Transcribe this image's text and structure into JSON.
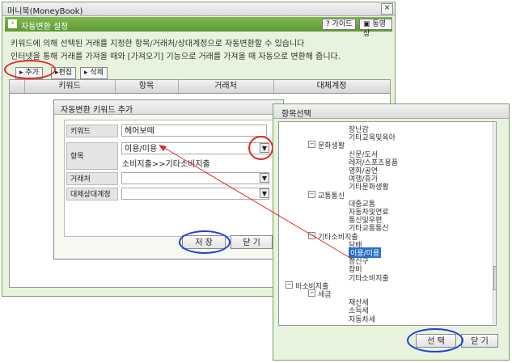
{
  "main": {
    "window_title": "머니북(MoneyBook)",
    "close": "×",
    "header": "자동변환 설정",
    "guide_button": "? 가이드",
    "video_button": "동영상",
    "desc_line1": "키워드에 의해 선택된 거래를 지정한 항목/거래처/상대계정으로 자동변환할 수 있습니다",
    "desc_line2": "인터넷을 통해 거래를 가져올 때와 [가져오기] 기능으로 거래를 가져올 때 자동으로 변환해 줍니다.",
    "toolbar": {
      "add": "추가",
      "edit": "편집",
      "delete": "삭제"
    },
    "columns": [
      "키워드",
      "항목",
      "거래처",
      "대체계정"
    ]
  },
  "dialog": {
    "title": "자동변환 키워드 추가",
    "labels": {
      "keyword": "키워드",
      "item": "항목",
      "vendor": "거래처",
      "counter": "대체상대계정"
    },
    "keyword_value": "헤어보떼",
    "item_value": "이용/미용",
    "item_path": "소비지출>>기타소비지출",
    "save": "저 장",
    "close": "닫 기"
  },
  "tree": {
    "title": "항목선택",
    "items": [
      {
        "label": "장난감",
        "level": 3
      },
      {
        "label": "기타교육및육아",
        "level": 3
      },
      {
        "label": "문화생활",
        "level": 2,
        "toggle": "−"
      },
      {
        "label": "신문/도서",
        "level": 3
      },
      {
        "label": "레저/스포츠용품",
        "level": 3
      },
      {
        "label": "영화/공연",
        "level": 3
      },
      {
        "label": "여행/휴가",
        "level": 3
      },
      {
        "label": "기타문화생활",
        "level": 3
      },
      {
        "label": "교통통신",
        "level": 2,
        "toggle": "−"
      },
      {
        "label": "대중교통",
        "level": 3
      },
      {
        "label": "자동차및연료",
        "level": 3
      },
      {
        "label": "통신및우편",
        "level": 3
      },
      {
        "label": "기타교통통신",
        "level": 3
      },
      {
        "label": "기타소비지출",
        "level": 2,
        "toggle": "−"
      },
      {
        "label": "담배",
        "level": 3
      },
      {
        "label": "이용/미용",
        "level": 3,
        "selected": true
      },
      {
        "label": "장신구",
        "level": 3
      },
      {
        "label": "잡비",
        "level": 3
      },
      {
        "label": "기타소비지출",
        "level": 3
      },
      {
        "label": "비소비지출",
        "level": 1,
        "toggle": "−"
      },
      {
        "label": "세금",
        "level": 2,
        "toggle": "−"
      },
      {
        "label": "재산세",
        "level": 3
      },
      {
        "label": "소득세",
        "level": 3
      },
      {
        "label": "자동차세",
        "level": 3
      }
    ],
    "select": "선 택",
    "close": "닫 기"
  },
  "colors": {
    "highlight_red": "#e8262a",
    "highlight_blue": "#1f3fd6",
    "header_green": "#6aa63e",
    "selection": "#2a6fcf"
  }
}
